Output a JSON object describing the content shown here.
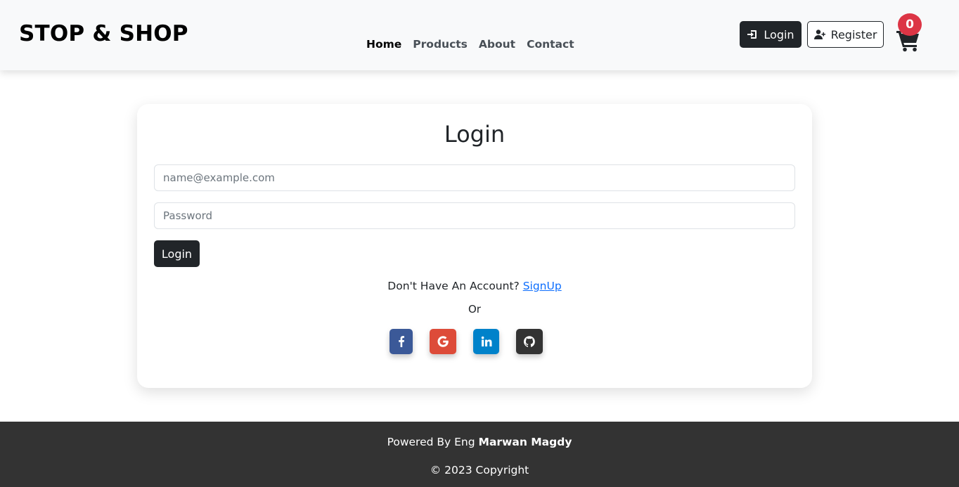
{
  "header": {
    "brand": "STOP & SHOP",
    "nav": [
      "Home",
      "Products",
      "About",
      "Contact"
    ],
    "login_label": "Login",
    "register_label": "Register",
    "cart_count": "0"
  },
  "login_card": {
    "title": "Login",
    "email_placeholder": "name@example.com",
    "password_placeholder": "Password",
    "submit_label": "Login",
    "signup_prompt": "Don't Have An Account? ",
    "signup_link": "SignUp",
    "or_label": "Or",
    "social": [
      "facebook-icon",
      "google-icon",
      "linkedin-icon",
      "github-icon"
    ]
  },
  "footer": {
    "powered_prefix": "Powered By Eng ",
    "author": "Marwan Magdy",
    "copyright": "© 2023 Copyright"
  },
  "colors": {
    "dark": "#212529",
    "danger": "#dc3545",
    "link": "#0d6efd",
    "facebook": "#3b5998",
    "google": "#dd4b39",
    "linkedin": "#0082ca",
    "github": "#333333",
    "footer_bg": "#333333"
  }
}
